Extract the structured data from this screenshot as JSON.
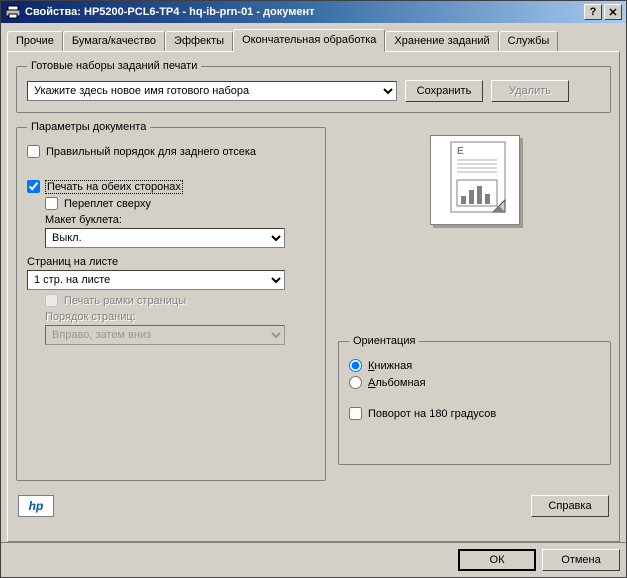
{
  "window": {
    "title": "Свойства: HP5200-PCL6-TP4 - hq-ib-prn-01 - документ"
  },
  "tabs": {
    "items": [
      "Прочие",
      "Бумага/качество",
      "Эффекты",
      "Окончательная обработка",
      "Хранение заданий",
      "Службы"
    ],
    "active_index": 3
  },
  "presets": {
    "legend": "Готовые наборы заданий печати",
    "combo_value": "Укажите здесь новое имя готового набора",
    "save_btn": "Сохранить",
    "delete_btn": "Удалить"
  },
  "doc_params": {
    "legend": "Параметры документа",
    "correct_order": {
      "label": "Правильный порядок для заднего отсека",
      "checked": false
    },
    "duplex": {
      "label": "Печать на обеих сторонах",
      "checked": true
    },
    "flip_up": {
      "label": "Переплет сверху",
      "checked": false
    },
    "booklet_label": "Макет буклета:",
    "booklet_value": "Выкл.",
    "pps_label": "Страниц на листе",
    "pps_value": "1 стр. на листе",
    "page_border": {
      "label": "Печать рамки страницы",
      "checked": false,
      "enabled": false
    },
    "page_order_label": "Порядок страниц:",
    "page_order_value": "Вправо, затем вниз",
    "page_order_enabled": false
  },
  "orientation": {
    "legend": "Ориентация",
    "portrait": "Книжная",
    "landscape": "Альбомная",
    "rotate180": {
      "label": "Поворот на 180 градусов",
      "checked": false
    },
    "selected": "portrait"
  },
  "help_btn": "Справка",
  "ok_btn": "ОК",
  "cancel_btn": "Отмена",
  "logo_text": "hp"
}
